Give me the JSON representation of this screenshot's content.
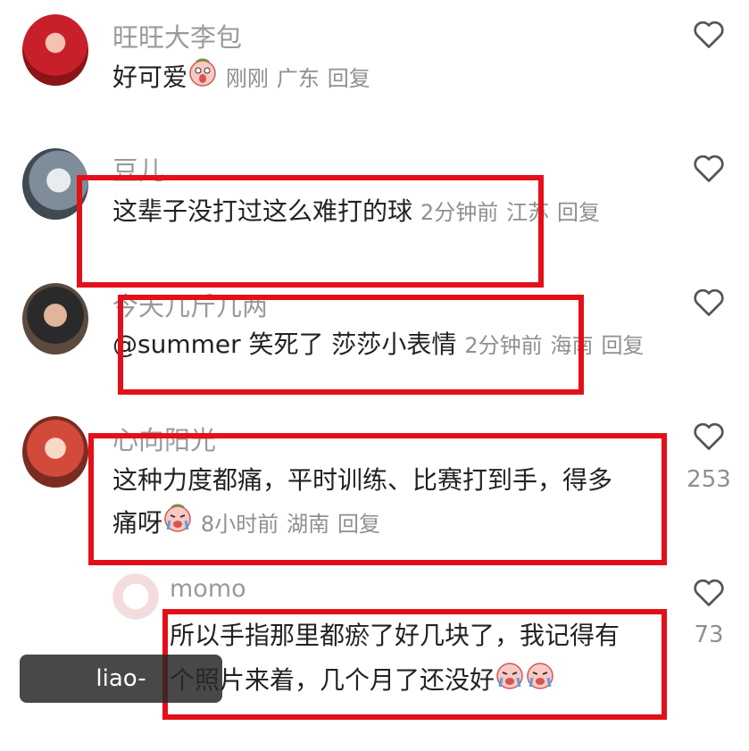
{
  "comments": [
    {
      "username": "旺旺大李包",
      "text": "好可爱",
      "time": "刚刚",
      "location": "广东",
      "reply": "回复",
      "likes": ""
    },
    {
      "username": "豆儿",
      "text": "这辈子没打过这么难打的球",
      "time": "2分钟前",
      "location": "江苏",
      "reply": "回复",
      "likes": ""
    },
    {
      "username": "今天几斤几两",
      "text": "@summer 笑死了 莎莎小表情",
      "time": "2分钟前",
      "location": "海南",
      "reply": "回复",
      "likes": ""
    },
    {
      "username": "心向阳光",
      "text_line1": "这种力度都痛，平时训练、比赛打到手，得多",
      "text_line2": "痛呀",
      "time": "8小时前",
      "location": "湖南",
      "reply": "回复",
      "likes": "253"
    },
    {
      "username": "momo",
      "text_line1": "所以手指那里都瘀了好几块了，我记得有",
      "text_line2": "个照片来着，几个月了还没好",
      "likes": "73"
    }
  ],
  "watermark": "liao-sports.com.cn",
  "icons": {
    "like": "heart-outline-icon",
    "emoji": "crying-emoji-icon"
  },
  "colors": {
    "highlight": "#e3101a",
    "meta": "#8f8f8f",
    "username": "#9a9a9a"
  }
}
